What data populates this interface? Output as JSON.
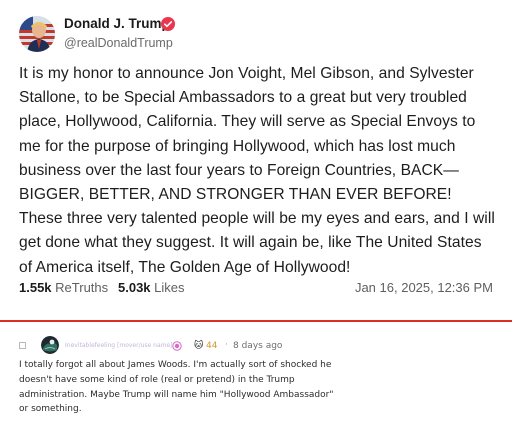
{
  "post": {
    "author_name": "Donald J. Trump",
    "author_handle": "@realDonaldTrump",
    "verified_color": "#e8374f",
    "body": "It is my honor to announce Jon Voight, Mel Gibson, and Sylvester Stallone, to be Special Ambassadors to a great but very troubled place, Hollywood, California. They will serve as Special Envoys to me for the purpose of bringing Hollywood, which has lost much business over the last four years to Foreign Countries, BACK—BIGGER, BETTER, AND STRONGER THAN EVER BEFORE! These three very talented people will be my eyes and ears, and I will get done what they suggest. It will again be, like The United States of America itself, The Golden Age of Hollywood!",
    "retruths_count": "1.55k",
    "retruths_label": "ReTruths",
    "likes_count": "5.03k",
    "likes_label": "Likes",
    "timestamp": "Jan 16, 2025, 12:36 PM"
  },
  "divider_color": "#d93025",
  "comment": {
    "username": "Inevitablefeeling [mover/use name]",
    "score": "44",
    "separator": "·",
    "time_ago": "8 days ago",
    "body": "I totally forgot all about James Woods. I'm actually sort of shocked he doesn't have some kind of role (real or pretend) in the Trump administration. Maybe Trump will name him \"Hollywood Ambassador\" or something."
  }
}
